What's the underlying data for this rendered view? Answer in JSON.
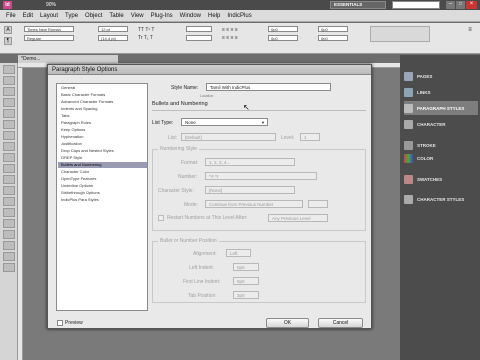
{
  "app": {
    "workspace": "ESSENTIALS",
    "zoom": "90%",
    "document_tab": "*Demo..."
  },
  "menubar": [
    "File",
    "Edit",
    "Layout",
    "Type",
    "Object",
    "Table",
    "View",
    "Plug-Ins",
    "Window",
    "Help",
    "IndicPlus"
  ],
  "control_bar": {
    "font_family": "Times New Roman",
    "font_style": "Regular",
    "font_size": "12 pt",
    "leading": "(14.4 pt)",
    "value_a": "0p0",
    "value_b": "0p0",
    "value_c": "0p0",
    "value_d": "0p0"
  },
  "right_panel": {
    "items": [
      {
        "label": "PAGES",
        "icon": "pages-icon"
      },
      {
        "label": "LINKS",
        "icon": "links-icon"
      },
      {
        "label": "PARAGRAPH STYLES",
        "icon": "paragraph-styles-icon"
      },
      {
        "label": "CHARACTER",
        "icon": "character-icon"
      },
      {
        "label": "STROKE",
        "icon": "stroke-icon"
      },
      {
        "label": "COLOR",
        "icon": "color-icon"
      },
      {
        "label": "SWATCHES",
        "icon": "swatches-icon"
      },
      {
        "label": "CHARACTER STYLES",
        "icon": "character-styles-icon"
      }
    ]
  },
  "dialog": {
    "title": "Paragraph Style Options",
    "style_name_label": "Style Name:",
    "style_name_value": "Tamil With IndicPlus",
    "location_label": "Location:",
    "section_title": "Bullets and Numbering",
    "list_type_label": "List Type:",
    "list_type_value": "None",
    "list_label": "List:",
    "list_value": "[Default]",
    "level_label": "Level:",
    "level_value": "1",
    "numbering_style_title": "Numbering Style",
    "format_label": "Format:",
    "format_value": "1, 2, 3, 4...",
    "number_label": "Number:",
    "number_value": "^#.^t",
    "char_style_label": "Character Style:",
    "char_style_value": "[None]",
    "mode_label": "Mode:",
    "mode_value": "Continue from Previous Number",
    "restart_label": "Restart Numbers at This Level After:",
    "restart_value": "Any Previous Level",
    "position_title": "Bullet or Number Position",
    "alignment_label": "Alignment:",
    "alignment_value": "Left",
    "left_indent_label": "Left Indent:",
    "left_indent_value": "0p0",
    "first_line_label": "First Line Indent:",
    "first_line_value": "0p0",
    "tab_position_label": "Tab Position:",
    "tab_position_value": "3p0",
    "preview_label": "Preview",
    "ok_label": "OK",
    "cancel_label": "Cancel",
    "categories": [
      "General",
      "Basic Character Formats",
      "Advanced Character Formats",
      "Indents and Spacing",
      "Tabs",
      "Paragraph Rules",
      "Keep Options",
      "Hyphenation",
      "Justification",
      "Drop Caps and Nested Styles",
      "GREP Style",
      "Bullets and Numbering",
      "Character Color",
      "OpenType Features",
      "Underline Options",
      "Strikethrough Options",
      "IndicPlus Para Styles"
    ],
    "selected_index": 11
  }
}
